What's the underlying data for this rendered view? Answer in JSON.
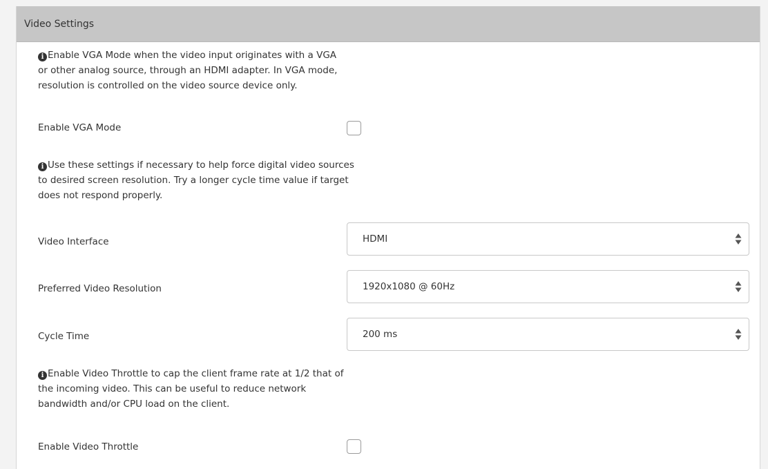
{
  "panel": {
    "title": "Video Settings"
  },
  "vga": {
    "info_text": "Enable VGA Mode when the video input originates with a VGA or other analog source, through an HDMI adapter. In VGA mode, resolution is controlled on the video source device only.",
    "info_lines": [
      "Enable VGA Mode when the video input originates with a VGA",
      "or other analog source, through an HDMI adapter. In VGA mode,",
      "resolution is controlled on the video source device only."
    ],
    "label": "Enable VGA Mode",
    "checked": false
  },
  "digital": {
    "info_lines": [
      "Use these settings if necessary to help force digital video sources",
      "to desired screen resolution. Try a longer cycle time value if target",
      "does not respond properly."
    ]
  },
  "video_interface": {
    "label": "Video Interface",
    "value": "HDMI"
  },
  "resolution": {
    "label": "Preferred Video Resolution",
    "value": "1920x1080 @ 60Hz"
  },
  "cycle_time": {
    "label": "Cycle Time",
    "value": "200 ms"
  },
  "throttle": {
    "info_lines": [
      "Enable Video Throttle to cap the client frame rate at 1/2 that of",
      "the incoming video. This can be useful to reduce network",
      "bandwidth and/or CPU load on the client."
    ],
    "label": "Enable Video Throttle",
    "checked": false
  },
  "icons": {
    "info": "info-circle-icon",
    "select_arrows": "sort-arrows-icon"
  },
  "colors": {
    "header_bg": "#c6c6c6",
    "panel_bg": "#ffffff",
    "page_bg": "#f3f3f3",
    "text": "#333333"
  }
}
